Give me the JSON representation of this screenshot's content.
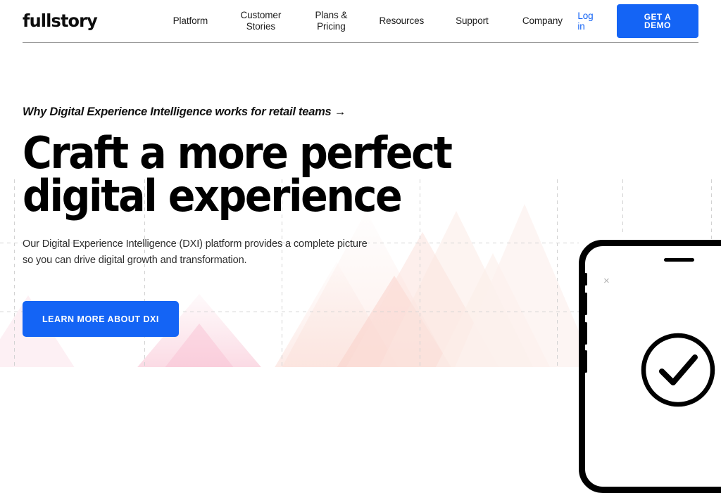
{
  "header": {
    "logo_text": "fullstory",
    "nav": [
      {
        "label": "Platform",
        "name": "nav-item-platform"
      },
      {
        "label": "Customer\nStories",
        "name": "nav-item-customer-stories"
      },
      {
        "label": "Plans &\nPricing",
        "name": "nav-item-plans-pricing"
      },
      {
        "label": "Resources",
        "name": "nav-item-resources"
      },
      {
        "label": "Support",
        "name": "nav-item-support"
      },
      {
        "label": "Company",
        "name": "nav-item-company"
      }
    ],
    "login_label": "Log in",
    "demo_label": "GET A DEMO"
  },
  "hero": {
    "eyebrow": "Why Digital Experience Intelligence works for retail teams →",
    "headline": "Craft a more perfect\ndigital experience",
    "subcopy": "Our Digital Experience Intelligence (DXI) platform provides a complete picture\nso you can drive digital growth and transformation.",
    "cta_label": "LEARN MORE ABOUT DXI"
  },
  "phone": {
    "close_glyph": "×",
    "status_icon": "check-circle-icon"
  },
  "colors": {
    "accent_blue": "#1464f5",
    "link_blue": "#1464f5",
    "text_dark": "#111111",
    "body_text": "#2e2e2e",
    "header_rule": "#9a9a9a",
    "grid_line": "#d8d8d8",
    "triangle_pink": "#fbd9e2",
    "triangle_peach": "#fbe3de"
  }
}
